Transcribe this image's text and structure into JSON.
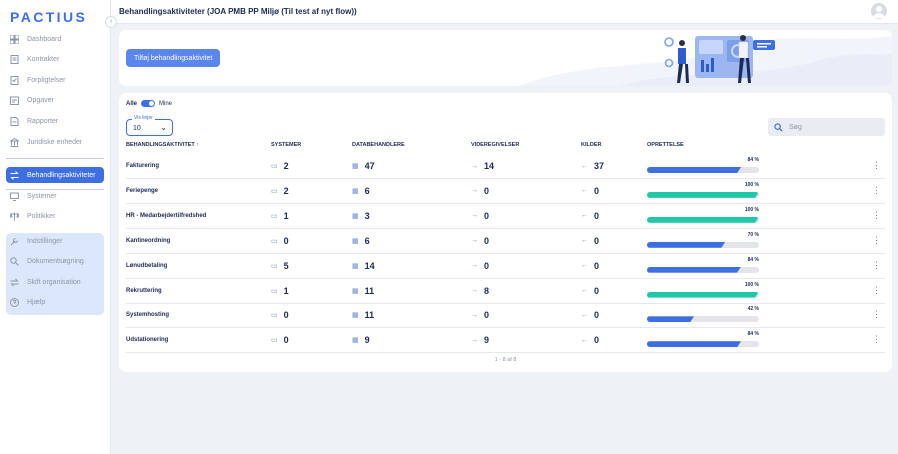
{
  "app": {
    "logo": "PACTIUS"
  },
  "sidebar": {
    "collapse_glyph": "‹",
    "items": [
      {
        "label": "Dashboard",
        "icon": "dashboard-icon"
      },
      {
        "label": "Kontrakter",
        "icon": "contract-icon"
      },
      {
        "label": "Forpligtelser",
        "icon": "obligation-icon"
      },
      {
        "label": "Opgaver",
        "icon": "task-icon"
      },
      {
        "label": "Rapporter",
        "icon": "report-icon"
      },
      {
        "label": "Juridiske enheder",
        "icon": "bank-icon"
      }
    ],
    "active_item": {
      "label": "Behandlingsaktiviteter",
      "icon": "transfer-icon"
    },
    "secondary_items": [
      {
        "label": "Systemer",
        "icon": "system-icon"
      },
      {
        "label": "Politikker",
        "icon": "scale-icon"
      }
    ],
    "settings_items": [
      {
        "label": "Indstillinger",
        "icon": "wrench-icon"
      },
      {
        "label": "Dokumentsøgning",
        "icon": "search-icon"
      },
      {
        "label": "Skift organisation",
        "icon": "switch-icon"
      },
      {
        "label": "Hjælp",
        "icon": "help-icon"
      }
    ]
  },
  "header": {
    "title": "Behandlingsaktiviteter (JOA PMB PP Miljø (Til test af nyt flow))"
  },
  "banner": {
    "add_button": "Tilføj behandlingsaktivitet"
  },
  "filters": {
    "toggle_left": "Alle",
    "toggle_right": "Mine",
    "rows_label": "Vis linjer",
    "rows_value": "10",
    "search_placeholder": "Søg"
  },
  "table": {
    "columns": {
      "name": "BEHANDLINGSAKTIVITET",
      "systems": "SYSTEMER",
      "processors": "DATABEHANDLERE",
      "transfers": "VIDEREGIVELSER",
      "sources": "KILDER",
      "creation": "OPRETTELSE"
    },
    "rows": [
      {
        "name": "Fakturering",
        "systems": "2",
        "processors": "47",
        "transfers": "14",
        "sources": "37",
        "progress": 84,
        "progress_label": "84 %"
      },
      {
        "name": "Feriepenge",
        "systems": "2",
        "processors": "6",
        "transfers": "0",
        "sources": "0",
        "progress": 100,
        "progress_label": "100 %"
      },
      {
        "name": "HR - Medarbejdertilfredshed",
        "systems": "1",
        "processors": "3",
        "transfers": "0",
        "sources": "0",
        "progress": 100,
        "progress_label": "100 %"
      },
      {
        "name": "Kantineordning",
        "systems": "0",
        "processors": "6",
        "transfers": "0",
        "sources": "0",
        "progress": 70,
        "progress_label": "70 %"
      },
      {
        "name": "Lønudbetaling",
        "systems": "5",
        "processors": "14",
        "transfers": "0",
        "sources": "0",
        "progress": 84,
        "progress_label": "84 %"
      },
      {
        "name": "Rekruttering",
        "systems": "1",
        "processors": "11",
        "transfers": "8",
        "sources": "0",
        "progress": 100,
        "progress_label": "100 %"
      },
      {
        "name": "Systemhosting",
        "systems": "0",
        "processors": "11",
        "transfers": "0",
        "sources": "0",
        "progress": 42,
        "progress_label": "42 %"
      },
      {
        "name": "Udstationering",
        "systems": "0",
        "processors": "9",
        "transfers": "9",
        "sources": "0",
        "progress": 84,
        "progress_label": "84 %"
      }
    ],
    "pagination": "1 - 8 af 8"
  },
  "colors": {
    "accent": "#3d6fe0",
    "complete": "#1fc9a8",
    "partial": "#3d6fe0",
    "track": "#e3e5ea"
  }
}
